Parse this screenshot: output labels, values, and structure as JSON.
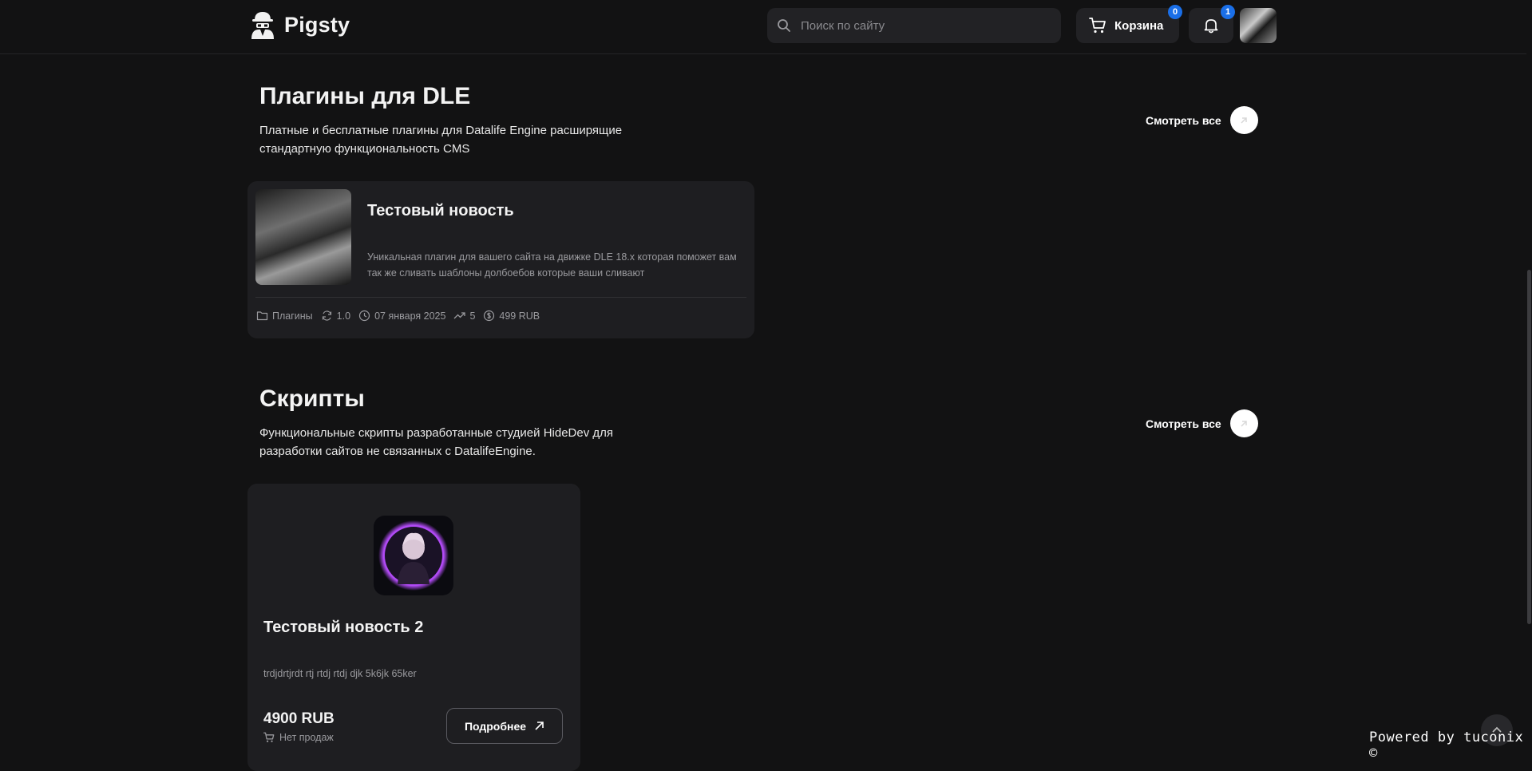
{
  "header": {
    "logo_text": "Pigsty",
    "search_placeholder": "Поиск по сайту",
    "cart_label": "Корзина",
    "cart_count": "0",
    "notifications_count": "1"
  },
  "sections": [
    {
      "title": "Плагины для DLE",
      "description": "Платные и бесплатные плагины для Datalife Engine расширящие стандартную функциональность CMS",
      "see_all_label": "Смотреть все"
    },
    {
      "title": "Скрипты",
      "description": "Функциональные скрипты разработанные студией HideDev для разработки сайтов не связанных с DatalifeEngine.",
      "see_all_label": "Смотреть все"
    }
  ],
  "plugin_card": {
    "title": "Тестовый новость",
    "description": "Уникальная плагин для вашего сайта на движке DLE 18.x которая поможет вам так же сливать шаблоны долбоебов которые ваши сливают",
    "category": "Плагины",
    "version": "1.0",
    "date": "07 января 2025",
    "trend": "5",
    "price": "499 RUB"
  },
  "script_card": {
    "title": "Тестовый новость 2",
    "description": "trdjdrtjrdt rtj rtdj rtdj djk 5k6jk 65ker",
    "price": "4900 RUB",
    "sales": "Нет продаж",
    "details_button": "Подробнее"
  },
  "footer": {
    "powered": "Powered by tuconix ©"
  },
  "colors": {
    "background": "#121213",
    "card": "#1e1e21",
    "badge": "#1a6fe8"
  }
}
